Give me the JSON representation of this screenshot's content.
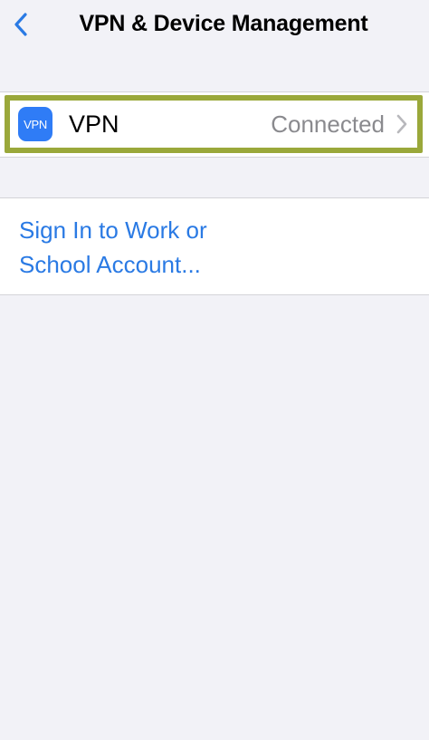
{
  "header": {
    "back_icon": "chevron-left-icon",
    "title": "VPN & Device Management"
  },
  "vpn_row": {
    "badge_text": "VPN",
    "label": "VPN",
    "status": "Connected",
    "chevron_icon": "chevron-right-icon",
    "highlight_color": "#9aa83a"
  },
  "account": {
    "link_line1": "Sign In to Work or",
    "link_line2": "School Account..."
  },
  "colors": {
    "background": "#f2f2f7",
    "accent_blue": "#2a7ae4",
    "vpn_badge": "#2f7cf6",
    "secondary_text": "#8a8a8e"
  }
}
